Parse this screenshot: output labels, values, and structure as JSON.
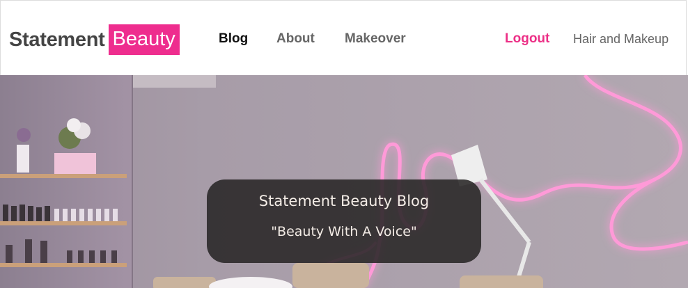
{
  "brand": {
    "name_main": "Statement",
    "name_accent": "Beauty"
  },
  "nav": {
    "blog": "Blog",
    "about": "About",
    "makeover": "Makeover",
    "logout": "Logout",
    "hair_makeup": "Hair and Makeup"
  },
  "hero": {
    "title": "Statement Beauty Blog",
    "tagline": "\"Beauty With A Voice\""
  },
  "colors": {
    "accent": "#ee2d8e",
    "logout": "#ec2f86",
    "caption_bg": "#282526"
  }
}
